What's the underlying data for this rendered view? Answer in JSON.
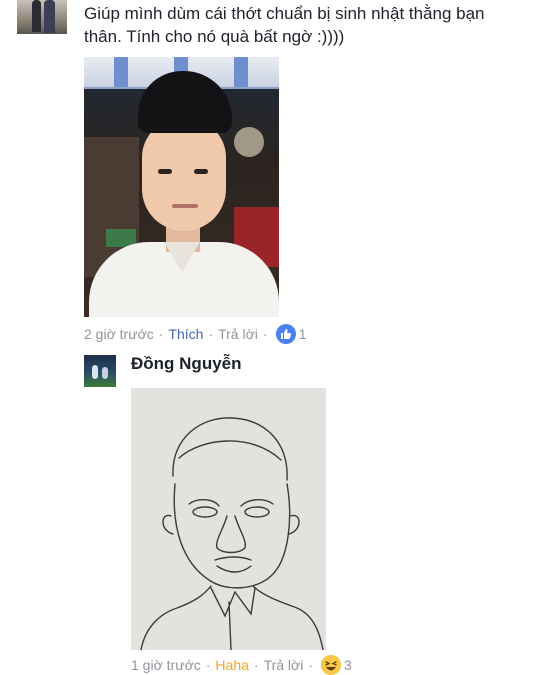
{
  "post": {
    "text": "Giúp mình dùm cái thớt chuẩn bị sinh nhật thằng bạn thân. Tính cho nó quà bất ngờ :))))",
    "image_alt": "selfie of young man in white shirt"
  },
  "comment1": {
    "time": "2 giờ trước",
    "react_label": "Thích",
    "reply_label": "Trả lời",
    "reaction_icon": "like-icon",
    "reaction_count": "1",
    "accent": "#4267b2"
  },
  "comment2": {
    "author": "Đồng Nguyễn",
    "time": "1 giờ trước",
    "react_label": "Haha",
    "reply_label": "Trả lời",
    "reaction_icon": "haha-icon",
    "reaction_count": "3",
    "accent": "#f5a623"
  },
  "separator": "·"
}
